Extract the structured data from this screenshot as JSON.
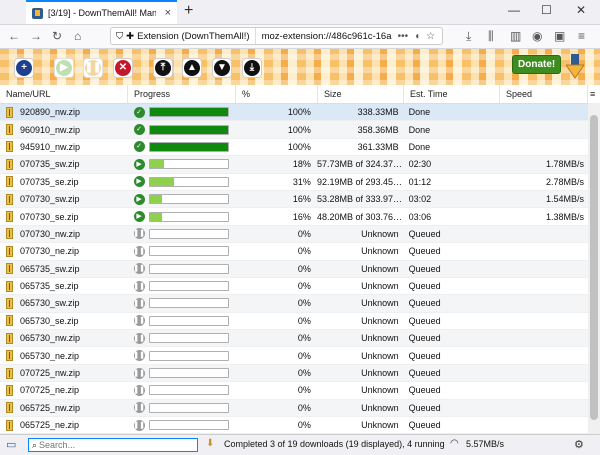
{
  "browser": {
    "tab_title": "[3/19] - DownThemAll! Manager",
    "tab_close": "×",
    "new_tab": "+",
    "win_min": "—",
    "win_max": "☐",
    "win_close": "✕",
    "identity_label": "Extension (DownThemAll!)",
    "address": "moz-extension://486c961c-16a…",
    "more": "•••"
  },
  "toolbar": {
    "donate_label": "Donate!"
  },
  "columns": {
    "name": "Name/URL",
    "progress": "Progress",
    "percent": "%",
    "size": "Size",
    "eta": "Est. Time",
    "speed": "Speed"
  },
  "colors": {
    "done": "#0f8a0f",
    "running": "#8fd14f",
    "accent": "#0a84ff"
  },
  "downloads": [
    {
      "name": "920890_nw.zip",
      "state": "done",
      "progress": 1.0,
      "percent": "100%",
      "size": "338.33MB",
      "eta": "Done",
      "speed": ""
    },
    {
      "name": "960910_nw.zip",
      "state": "done",
      "progress": 1.0,
      "percent": "100%",
      "size": "358.36MB",
      "eta": "Done",
      "speed": ""
    },
    {
      "name": "945910_nw.zip",
      "state": "done",
      "progress": 1.0,
      "percent": "100%",
      "size": "361.33MB",
      "eta": "Done",
      "speed": ""
    },
    {
      "name": "070735_sw.zip",
      "state": "running",
      "progress": 0.18,
      "percent": "18%",
      "size": "57.73MB of 324.37…",
      "eta": "02:30",
      "speed": "1.78MB/s"
    },
    {
      "name": "070735_se.zip",
      "state": "running",
      "progress": 0.31,
      "percent": "31%",
      "size": "92.19MB of 293.45…",
      "eta": "01:12",
      "speed": "2.78MB/s"
    },
    {
      "name": "070730_sw.zip",
      "state": "running",
      "progress": 0.16,
      "percent": "16%",
      "size": "53.28MB of 333.97…",
      "eta": "03:02",
      "speed": "1.54MB/s"
    },
    {
      "name": "070730_se.zip",
      "state": "running",
      "progress": 0.16,
      "percent": "16%",
      "size": "48.20MB of 303.76…",
      "eta": "03:06",
      "speed": "1.38MB/s"
    },
    {
      "name": "070730_nw.zip",
      "state": "queued",
      "progress": 0,
      "percent": "0%",
      "size": "Unknown",
      "eta": "Queued",
      "speed": ""
    },
    {
      "name": "070730_ne.zip",
      "state": "queued",
      "progress": 0,
      "percent": "0%",
      "size": "Unknown",
      "eta": "Queued",
      "speed": ""
    },
    {
      "name": "065735_sw.zip",
      "state": "queued",
      "progress": 0,
      "percent": "0%",
      "size": "Unknown",
      "eta": "Queued",
      "speed": ""
    },
    {
      "name": "065735_se.zip",
      "state": "queued",
      "progress": 0,
      "percent": "0%",
      "size": "Unknown",
      "eta": "Queued",
      "speed": ""
    },
    {
      "name": "065730_sw.zip",
      "state": "queued",
      "progress": 0,
      "percent": "0%",
      "size": "Unknown",
      "eta": "Queued",
      "speed": ""
    },
    {
      "name": "065730_se.zip",
      "state": "queued",
      "progress": 0,
      "percent": "0%",
      "size": "Unknown",
      "eta": "Queued",
      "speed": ""
    },
    {
      "name": "065730_nw.zip",
      "state": "queued",
      "progress": 0,
      "percent": "0%",
      "size": "Unknown",
      "eta": "Queued",
      "speed": ""
    },
    {
      "name": "065730_ne.zip",
      "state": "queued",
      "progress": 0,
      "percent": "0%",
      "size": "Unknown",
      "eta": "Queued",
      "speed": ""
    },
    {
      "name": "070725_nw.zip",
      "state": "queued",
      "progress": 0,
      "percent": "0%",
      "size": "Unknown",
      "eta": "Queued",
      "speed": ""
    },
    {
      "name": "070725_ne.zip",
      "state": "queued",
      "progress": 0,
      "percent": "0%",
      "size": "Unknown",
      "eta": "Queued",
      "speed": ""
    },
    {
      "name": "065725_nw.zip",
      "state": "queued",
      "progress": 0,
      "percent": "0%",
      "size": "Unknown",
      "eta": "Queued",
      "speed": ""
    },
    {
      "name": "065725_ne.zip",
      "state": "queued",
      "progress": 0,
      "percent": "0%",
      "size": "Unknown",
      "eta": "Queued",
      "speed": ""
    }
  ],
  "status": {
    "search_placeholder": "Search...",
    "summary": "Completed 3 of 19 downloads (19 displayed), 4 running",
    "speed": "5.57MB/s"
  }
}
